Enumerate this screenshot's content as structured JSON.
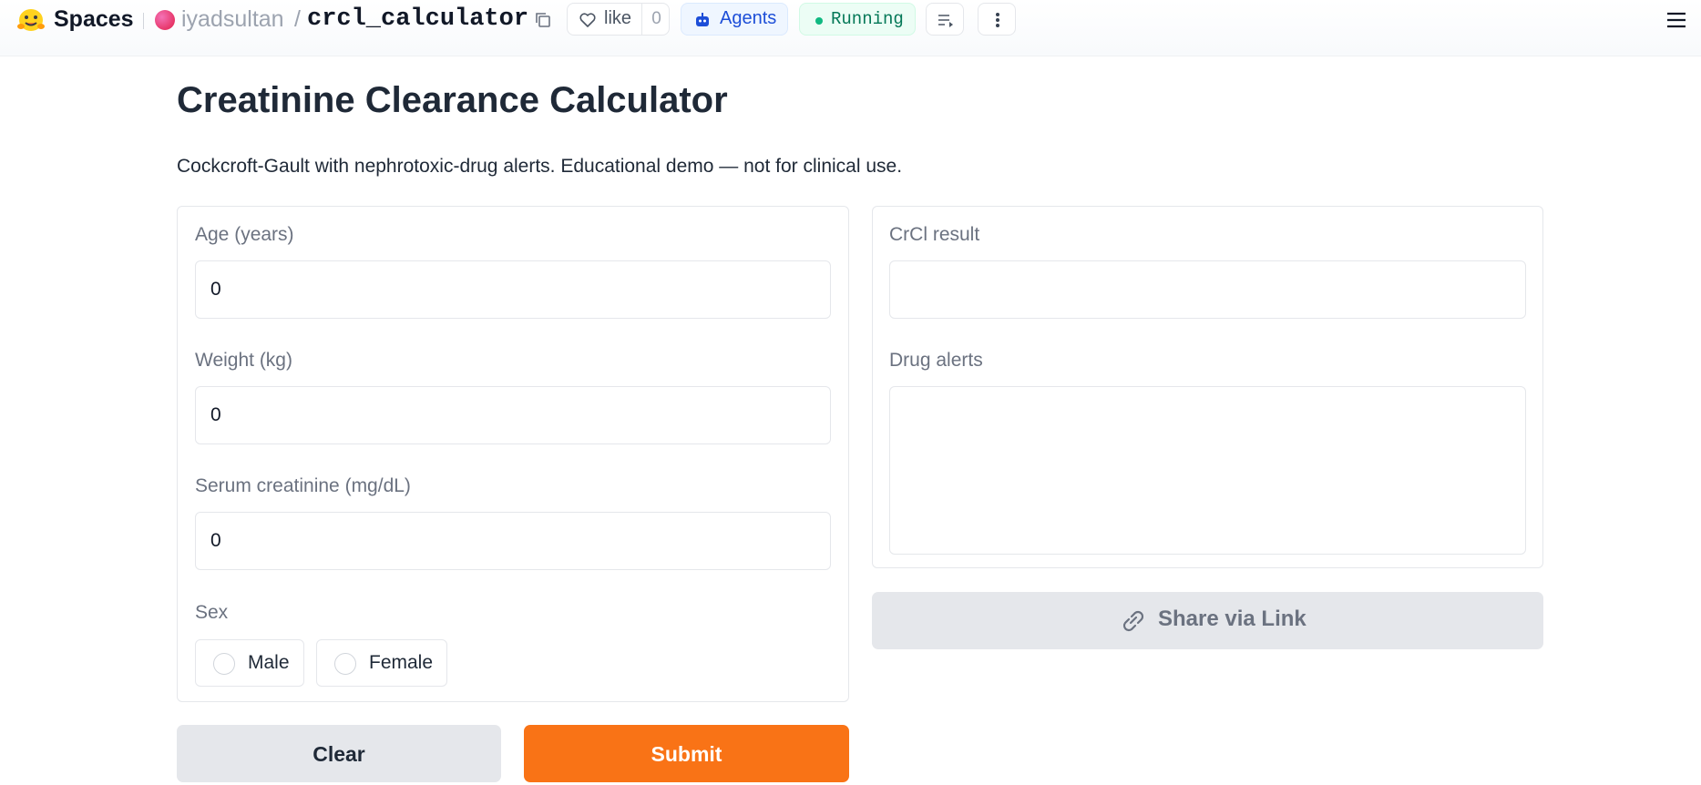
{
  "header": {
    "brand_label": "Spaces",
    "owner": "iyadsultan",
    "separator": "/",
    "repo": "crcl_calculator",
    "like_label": "like",
    "like_count": "0",
    "agents_label": "Agents",
    "status_label": "Running",
    "icons": [
      "hugging-face-logo",
      "copy-icon",
      "heart-icon",
      "robot-icon",
      "list-icon",
      "more-vertical-icon",
      "menu-icon"
    ]
  },
  "page": {
    "title": "Creatinine Clearance Calculator",
    "description": "Cockcroft-Gault with nephrotoxic-drug alerts. Educational demo — not for clinical use."
  },
  "inputs": {
    "age": {
      "label": "Age (years)",
      "value": "0"
    },
    "weight": {
      "label": "Weight (kg)",
      "value": "0"
    },
    "creatinine": {
      "label": "Serum creatinine (mg/dL)",
      "value": "0"
    },
    "sex": {
      "label": "Sex",
      "options": [
        "Male",
        "Female"
      ],
      "selected": null
    }
  },
  "outputs": {
    "crcl": {
      "label": "CrCl result",
      "value": ""
    },
    "alerts": {
      "label": "Drug alerts",
      "value": ""
    }
  },
  "actions": {
    "clear_label": "Clear",
    "submit_label": "Submit",
    "share_label": "Share via Link"
  },
  "colors": {
    "submit": "#f97316",
    "running": "#10b981",
    "agents": "#1d4ed8"
  }
}
